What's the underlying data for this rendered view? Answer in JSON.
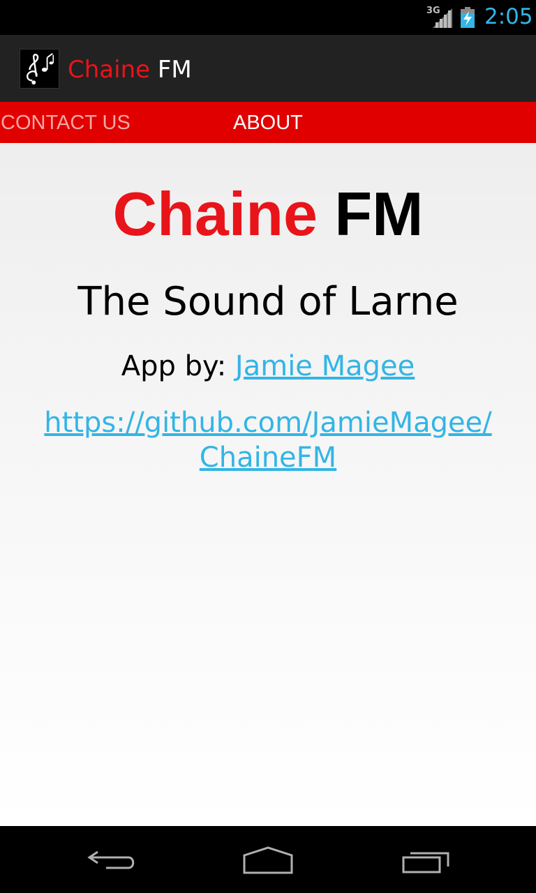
{
  "status_bar": {
    "network": "3G",
    "time": "2:05",
    "icons": [
      "signal-icon",
      "battery-charging-icon"
    ],
    "clock_color": "#33b5e5"
  },
  "action_bar": {
    "icon": "music-notes-icon",
    "title_part1": "Chaine",
    "title_part2": " FM"
  },
  "tabs": [
    {
      "label": "CONTACT US"
    },
    {
      "label": "ABOUT",
      "selected": true
    }
  ],
  "about": {
    "headline_part1": "Chaine",
    "headline_part2": " FM",
    "tagline": "The Sound of Larne",
    "credit_prefix": "App by: ",
    "author_link": "Jamie Magee",
    "repo_link_line1": "https://github.com/JamieMagee/",
    "repo_link_line2": "ChaineFM"
  },
  "nav_bar": {
    "buttons": [
      "back-icon",
      "home-icon",
      "recent-apps-icon"
    ]
  },
  "colors": {
    "brand_red": "#e8141a",
    "tab_bar": "#e10000",
    "action_bar": "#222222",
    "link": "#33b5e5"
  }
}
